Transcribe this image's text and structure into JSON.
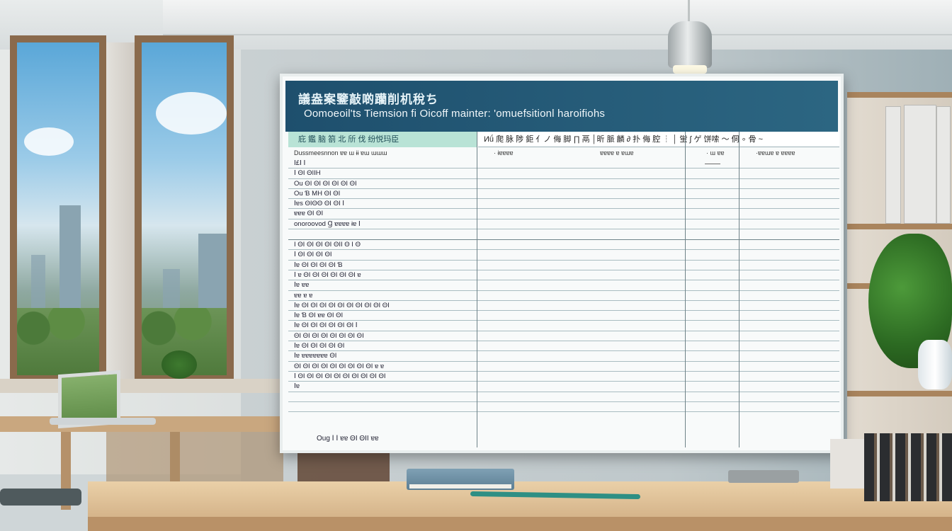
{
  "board": {
    "title_cn": "議盎案鑒敲啲躪削机稅ち",
    "title_en": "Oomoeoil'ts Tiemsion fi Oicoff mainter: 'omuefsitionl haroifiohs",
    "header_left": "庇 鑑 脑 箚 北     斦 伐      纷悦玛臣",
    "header_right": "Иǘ 爬 脉 陟  鉅 亻ノ 侮 脚 ∏   鬲 │昕 脈 麟 ∂ 扑 侮  腔  ┆ │ 蛍 ∫    ゲ 饼嗦 ～ 侗 ∘ 骨 ~",
    "sub_header": [
      "Dussmeesnnon   ɐɐ ɯ ɨɨ ɐɯ  ɯɯɯ",
      "· ɨɐɐɐɐ",
      "ɐɐɐɐ   ɐ ɐɯɐ",
      "· ɯ ɐɐ",
      "·ɐɐɯɐ  ɐ ɐɐɐɐ"
    ],
    "group1_rows": [
      "Ⅰ£Ⅰ Ⅰ",
      "Ⅰ ΘΙ ΘΙΙΗ",
      "Ou ΘΙ ΘΙ ΘΙ ΘΙ ΘΙ ΘΙ",
      "Ou Ɓ ΜΗ ΘΙ ΘΙ",
      "Ⅰɐs ΘΙΘΘ ΘΙ ΘΙ Ⅰ",
      "ɐɐɐ ΘΙ ΘΙ",
      "onoroovod   Ɡ ɐɐɐɐ ɨɐ   Ⅰ"
    ],
    "group2_rows": [
      "Ι ΘΙ ΘΙ ΘΙ ΘΙ ΘΙΙ Θ Ι Θ",
      "Ⅰ ΘΙ ΘΙ ΘΙ ΘΙ",
      "Ⅰɐ ΘΙ ΘΙ ΘΙ ΘΙ Ɓ",
      "Ⅰ ɐ ΘΙ ΘΙ ΘΙ ΘΙ ΘΙ ΘΙ ɐ",
      "Ⅰɐ ɐɐ",
      "ɐɐ ɐ ɐ",
      "Ⅰɐ ΘΙ ΘΙ ΘΙ ΘΙ ΘΙ ΘΙ ΘΙ ΘΙ ΘΙ ΘΙ",
      "Ⅰɐ Ɓ ΘΙ ɐɐ ΘΙ ΘΙ",
      "Ⅰɐ ΘΙ ΘΙ ΘΙ ΘΙ ΘΙ ΘΙ Ⅰ",
      "ΘΙ ΘΙ ΘΙ ΘΙ ΘΙ ΘΙ ΘΙ ΘΙ",
      "Ⅰɐ ΘΙ ΘΙ ΘΙ ΘΙ ΘΙ",
      "Ⅰɐ ɐɐɐɐɐɐɐ ΘΙ",
      "ΘΙ ΘΙ ΘΙ ΘΙ ΘΙ ΘΙ ΘΙ ΘΙ ΘΙ ɐ ɐ",
      "Ⅰ ΘΙ ΘΙ ΘΙ ΘΙ ΘΙ ΘΙ ΘΙ ΘΙ ΘΙ ΘΙ",
      "Ⅰɐ"
    ],
    "footer": "Oug Ⅰ Ⅰ ɐɐ ΘΙ ΘΙΙ ɐɐ"
  },
  "colors": {
    "header_band": "#1e4f6d",
    "header_left_fill": "#b9e3d6",
    "grid_line": "#6f8288",
    "desk_wood": "#ead0a8",
    "window_frame": "#8a6a4c"
  }
}
